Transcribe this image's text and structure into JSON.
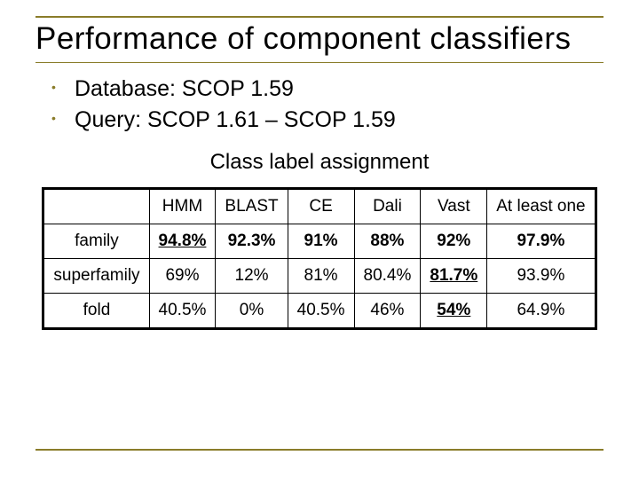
{
  "title": "Performance of component classifiers",
  "bullets": [
    "Database: SCOP 1.59",
    "Query: SCOP 1.61 – SCOP 1.59"
  ],
  "table_caption": "Class label assignment",
  "chart_data": {
    "type": "table",
    "columns": [
      "HMM",
      "BLAST",
      "CE",
      "Dali",
      "Vast",
      "At least one"
    ],
    "rows": [
      {
        "label": "family",
        "values": [
          "94.8%",
          "92.3%",
          "91%",
          "88%",
          "92%",
          "97.9%"
        ]
      },
      {
        "label": "superfamily",
        "values": [
          "69%",
          "12%",
          "81%",
          "80.4%",
          "81.7%",
          "93.9%"
        ]
      },
      {
        "label": "fold",
        "values": [
          "40.5%",
          "0%",
          "40.5%",
          "46%",
          "54%",
          "64.9%"
        ]
      }
    ],
    "emphasis": {
      "bold_row_label": "family",
      "bold_underline_cells": [
        {
          "row": 0,
          "col": 0
        },
        {
          "row": 1,
          "col": 4
        },
        {
          "row": 2,
          "col": 4
        }
      ]
    }
  }
}
